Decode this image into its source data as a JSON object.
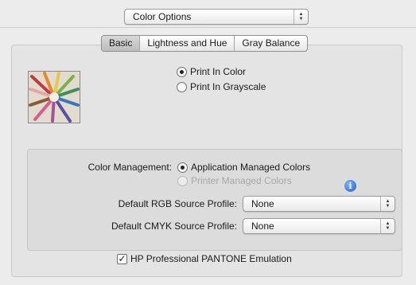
{
  "options_popup": {
    "value": "Color Options"
  },
  "tabs": [
    "Basic",
    "Lightness and Hue",
    "Gray Balance"
  ],
  "print_mode": {
    "options": [
      "Print In Color",
      "Print In Grayscale"
    ],
    "selected": "Print In Color"
  },
  "color_management": {
    "label": "Color Management:",
    "options": [
      "Application Managed Colors",
      "Printer Managed Colors"
    ],
    "selected": "Application Managed Colors",
    "disabled": "Printer Managed Colors"
  },
  "info_icon": "i",
  "rgb_profile": {
    "label": "Default RGB Source Profile:",
    "value": "None"
  },
  "cmyk_profile": {
    "label": "Default CMYK Source Profile:",
    "value": "None"
  },
  "pantone": {
    "label": "HP Professional PANTONE Emulation",
    "checked": true,
    "mark": "✓"
  },
  "icons": {
    "thumbnail": "colored-pencils-image",
    "info": "info-icon"
  }
}
